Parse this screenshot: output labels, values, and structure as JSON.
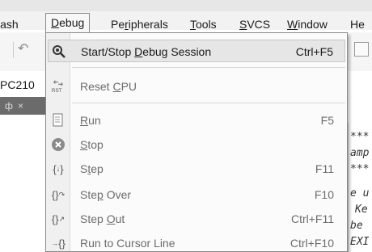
{
  "menubar": {
    "items": [
      {
        "label": "Flash",
        "visible": "lash"
      },
      {
        "label": "Debug"
      },
      {
        "label": "Peripherals"
      },
      {
        "label": "Tools"
      },
      {
        "label": "SVCS"
      },
      {
        "label": "Window"
      },
      {
        "label": "Help",
        "visible": "He"
      }
    ]
  },
  "target": {
    "value": "PC210"
  },
  "panel": {
    "pin": "ф",
    "close": "×"
  },
  "editor": {
    "lines": [
      "***",
      "amp",
      "***",
      "e u",
      "Ke",
      "be",
      "EXI"
    ]
  },
  "debug_menu": {
    "items": [
      {
        "label": "Start/Stop Debug Session",
        "shortcut": "Ctrl+F5",
        "icon": "debug-session-icon",
        "enabled": true
      },
      {
        "label": "Reset CPU",
        "shortcut": "",
        "icon": "reset-cpu-icon",
        "enabled": false
      },
      {
        "label": "Run",
        "shortcut": "F5",
        "icon": "run-icon",
        "enabled": false
      },
      {
        "label": "Stop",
        "shortcut": "",
        "icon": "stop-icon",
        "enabled": false
      },
      {
        "label": "Step",
        "shortcut": "F11",
        "icon": "step-icon",
        "enabled": false
      },
      {
        "label": "Step Over",
        "shortcut": "F10",
        "icon": "step-over-icon",
        "enabled": false
      },
      {
        "label": "Step Out",
        "shortcut": "Ctrl+F11",
        "icon": "step-out-icon",
        "enabled": false
      },
      {
        "label": "Run to Cursor Line",
        "shortcut": "Ctrl+F10",
        "icon": "run-to-cursor-icon",
        "enabled": false
      }
    ]
  },
  "colors": {
    "menu_highlight": "#e6e6e6",
    "disabled_text": "#6c6c6c",
    "panel_tab": "#6b6b6b"
  }
}
